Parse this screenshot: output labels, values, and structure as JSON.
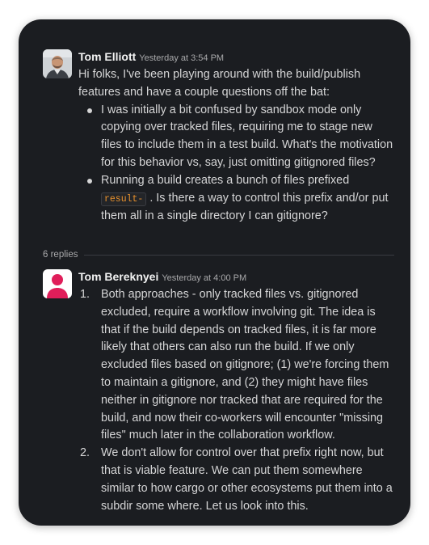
{
  "thread": {
    "first_message": {
      "author": "Tom Elliott",
      "timestamp": "Yesterday at 3:54 PM",
      "intro": "Hi folks, I've been playing around with the build/publish features and have a couple questions off the bat:",
      "bullets": [
        {
          "text": "I was initially a bit confused by sandbox mode only copying over tracked files, requiring me to stage new files to include them in a test build. What's the motivation for this behavior vs, say, just omitting gitignored files?"
        },
        {
          "text_before": "Running a build creates a bunch of files prefixed",
          "code": "result-",
          "text_after": ". Is there a way to control this prefix and/or put them all in a single directory I can gitignore?"
        }
      ]
    },
    "replies_count_label": "6 replies",
    "reply": {
      "author": "Tom Bereknyei",
      "timestamp": "Yesterday at 4:00 PM",
      "items": [
        {
          "number": "1.",
          "text": "Both approaches - only tracked files vs. gitignored excluded, require a workflow involving git. The idea is that if the build depends on tracked files, it is far more likely that others can also run the build. If we only excluded files based on gitignore; (1) we're forcing them to maintain a gitignore, and (2) they might have files neither in gitignore nor tracked that are required for the build, and now their co-workers will encounter \"missing files\" much later in the collaboration workflow."
        },
        {
          "number": "2.",
          "text": "We don't allow for control over that prefix right now, but that is viable feature. We can put them somewhere similar to how cargo or other ecosystems put them into a subdir some where. Let us look into this."
        }
      ]
    }
  },
  "colors": {
    "panel_bg": "#1b1d21",
    "text": "#d5d5d6",
    "author": "#f2f2f2",
    "muted": "#a9a9ab",
    "code": "#e8912d",
    "default_avatar": "#e01e5a"
  },
  "icons": [
    "user-photo-avatar",
    "default-person-avatar"
  ]
}
